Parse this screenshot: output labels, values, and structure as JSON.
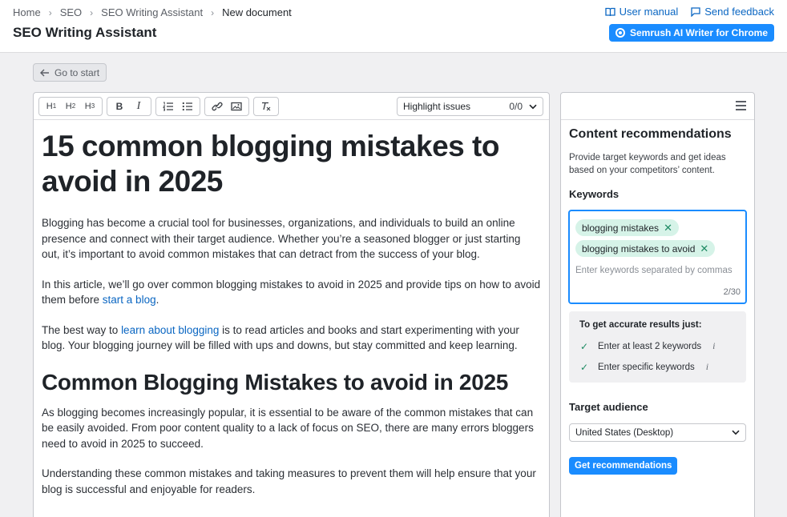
{
  "breadcrumb": [
    "Home",
    "SEO",
    "SEO Writing Assistant",
    "New document"
  ],
  "header": {
    "title": "SEO Writing Assistant",
    "user_manual": "User manual",
    "send_feedback": "Send feedback",
    "chrome_button": "Semrush AI Writer for Chrome"
  },
  "go_to_start": "Go to start",
  "toolbar": {
    "h1": "H",
    "h1_sub": "1",
    "h2": "H",
    "h2_sub": "2",
    "h3": "H",
    "h3_sub": "3",
    "bold": "B",
    "italic": "I",
    "highlight_label": "Highlight issues",
    "highlight_count": "0/0"
  },
  "article": {
    "title": "15 common blogging mistakes to avoid in 2025",
    "p1": "Blogging has become a crucial tool for businesses, organizations, and individuals to build an online presence and connect with their target audience. Whether you’re a seasoned blogger or just starting out, it’s important to avoid common mistakes that can detract from the success of your blog.",
    "p2_before": "In this article, we’ll go over common blogging mistakes to avoid in 2025 and provide tips on how to avoid them before ",
    "p2_link": "start a blog",
    "p2_after": ".",
    "p3_before": "The best way to ",
    "p3_link": "learn about blogging",
    "p3_after": " is to read articles and books and start experimenting with your blog. Your blogging journey will be filled with ups and downs, but stay committed and keep learning.",
    "h2": "Common Blogging Mistakes to avoid in 2025",
    "p4": "As blogging becomes increasingly popular, it is essential to be aware of the common mistakes that can be easily avoided. From poor content quality to a lack of focus on SEO, there are many errors bloggers need to avoid in 2025 to succeed.",
    "p5": "Understanding these common mistakes and taking measures to prevent them will help ensure that your blog is successful and enjoyable for readers."
  },
  "panel": {
    "title": "Content recommendations",
    "description": "Provide target keywords and get ideas based on your competitors’ content.",
    "keywords_label": "Keywords",
    "keywords": [
      "blogging mistakes",
      "blogging mistakes to avoid"
    ],
    "keywords_placeholder": "Enter keywords separated by commas",
    "keywords_count": "2/30",
    "tips_title": "To get accurate results just:",
    "tips": [
      "Enter at least 2 keywords",
      "Enter specific keywords"
    ],
    "audience_label": "Target audience",
    "audience_value": "United States (Desktop)",
    "get_button": "Get recommendations"
  },
  "colors": {
    "accent": "#1a8cff",
    "link": "#0a66c2",
    "chip_bg": "#d6f3e8",
    "check": "#1e8a63"
  }
}
